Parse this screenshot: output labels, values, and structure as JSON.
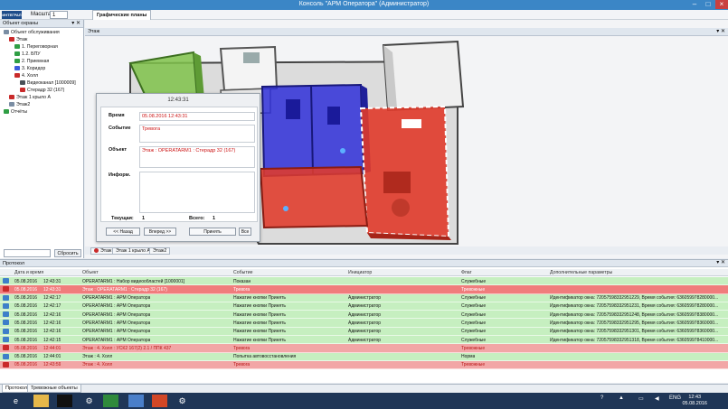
{
  "window": {
    "title": "Консоль \"АРМ Оператора\" (Администратор)"
  },
  "toolbar": {
    "logo_text": "ИНТЕГРАЛ",
    "scale_label": "Масштаб",
    "scale_value": "1",
    "plans_tab": "Графические планы"
  },
  "left_panel": {
    "title": "Объект охраны",
    "items": [
      {
        "label": "Объект обслуживания",
        "level": 0,
        "icon": "building-icon",
        "color": "#7a8da3"
      },
      {
        "label": "Этаж",
        "level": 1,
        "icon": "floor-icon",
        "color": "#c92a2a"
      },
      {
        "label": "1. Переговорная",
        "level": 2,
        "icon": "room-icon",
        "color": "#2f9e44"
      },
      {
        "label": "1.2. БПУ",
        "level": 2,
        "icon": "room-icon",
        "color": "#2f9e44"
      },
      {
        "label": "2. Приемная",
        "level": 2,
        "icon": "room-icon",
        "color": "#2f9e44"
      },
      {
        "label": "3. Коридор",
        "level": 2,
        "icon": "room-icon",
        "color": "#3b5bdb"
      },
      {
        "label": "4. Холл",
        "level": 2,
        "icon": "room-icon",
        "color": "#c92a2a"
      },
      {
        "label": "Видеоканал [1000009]",
        "level": 3,
        "icon": "camera-icon",
        "color": "#495057"
      },
      {
        "label": "Стерадр 32 (167)",
        "level": 3,
        "icon": "sensor-icon",
        "color": "#c92a2a"
      },
      {
        "label": "Этаж 1 крыло А",
        "level": 1,
        "icon": "floor-icon",
        "color": "#c92a2a"
      },
      {
        "label": "Этаж2",
        "level": 1,
        "icon": "floor-icon",
        "color": "#7a8da3"
      },
      {
        "label": "Отчёты",
        "level": 0,
        "icon": "reports-icon",
        "color": "#2f9e44"
      }
    ],
    "reset_label": "Сбросить"
  },
  "plan": {
    "panel_title": "Этаж",
    "floor_tabs": [
      "Этаж",
      "Этаж 1 крыло А",
      "Этаж2"
    ],
    "colors": {
      "green_zone": "#7fc24a",
      "blue_zone": "#2f2fd8",
      "red_zone": "#e03a2a"
    }
  },
  "event_dialog": {
    "time_header": "12:43:31",
    "time_label": "Время",
    "time_value": "05.08.2016 12:43:31",
    "event_label": "Событие",
    "event_value": "Тревога",
    "object_label": "Объект",
    "object_value": "Этаж : OPERATARM1 : Стерадр 32 (167)",
    "info_label": "Информ.",
    "current_label": "Текущая:",
    "current_value": "1",
    "total_label": "Всего:",
    "total_value": "1",
    "back_button": "<< Назад",
    "forward_button": "Вперед >>",
    "accept_button": "Принять",
    "all_button": "Все"
  },
  "protocol": {
    "title": "Протокол",
    "columns": [
      "Дата и время",
      "Объект",
      "Событие",
      "Инициатор",
      "Флаг",
      "Дополнительные параметры"
    ],
    "rows": [
      {
        "date": "05.08.2016",
        "time": "12:43:31",
        "object": "OPERATARM1 : Набор видеообластей [1000001]",
        "event": "Показан",
        "initiator": "",
        "flag": "Служебные",
        "params": "",
        "type": "green"
      },
      {
        "date": "05.08.2016",
        "time": "12:43:31",
        "object": "Этаж : OPERATARM1 : Стерадр 32 (167)",
        "event": "Тревога",
        "initiator": "",
        "flag": "Тревожные",
        "params": "",
        "type": "sel"
      },
      {
        "date": "05.08.2016",
        "time": "12:42:17",
        "object": "OPERATARM1 : АРМ Оператора",
        "event": "Нажатие кнопки Принять",
        "initiator": "Администратор",
        "flag": "Служебные",
        "params": "Идентификатор окна: 72057598332951229, Время события: 636059978280000...",
        "type": "green"
      },
      {
        "date": "05.08.2016",
        "time": "12:42:17",
        "object": "OPERATARM1 : АРМ Оператора",
        "event": "Нажатие кнопки Принять",
        "initiator": "Администратор",
        "flag": "Служебные",
        "params": "Идентификатор окна: 72057598332951231, Время события: 636059978280000...",
        "type": "green"
      },
      {
        "date": "05.08.2016",
        "time": "12:42:16",
        "object": "OPERATARM1 : АРМ Оператора",
        "event": "Нажатие кнопки Принять",
        "initiator": "Администратор",
        "flag": "Служебные",
        "params": "Идентификатор окна: 72057598332951248, Время события: 636059978380000...",
        "type": "green"
      },
      {
        "date": "05.08.2016",
        "time": "12:42:16",
        "object": "OPERATARM1 : АРМ Оператора",
        "event": "Нажатие кнопки Принять",
        "initiator": "Администратор",
        "flag": "Служебные",
        "params": "Идентификатор окна: 72057598332951295, Время события: 636059978360000...",
        "type": "green"
      },
      {
        "date": "05.08.2016",
        "time": "12:42:16",
        "object": "OPERATARM1 : АРМ Оператора",
        "event": "Нажатие кнопки Принять",
        "initiator": "Администратор",
        "flag": "Служебные",
        "params": "Идентификатор окна: 72057598332951301, Время события: 636059978360000...",
        "type": "green"
      },
      {
        "date": "05.08.2016",
        "time": "12:42:15",
        "object": "OPERATARM1 : АРМ Оператора",
        "event": "Нажатие кнопки Принять",
        "initiator": "Администратор",
        "flag": "Служебные",
        "params": "Идентификатор окна: 72057598332951318, Время события: 636059978410000...",
        "type": "green"
      },
      {
        "date": "05.08.2016",
        "time": "12:44:01",
        "object": "Этаж : 4. Холл : УСК2 167(2) 2.1 / ППК 437",
        "event": "Тревога",
        "initiator": "",
        "flag": "Тревожные",
        "params": "",
        "type": "red"
      },
      {
        "date": "05.08.2016",
        "time": "12:44:01",
        "object": "Этаж : 4. Холл",
        "event": "Попытка автовосстановления",
        "initiator": "",
        "flag": "Норма",
        "params": "",
        "type": "green"
      },
      {
        "date": "05.08.2016",
        "time": "12:43:59",
        "object": "Этаж : 4. Холл",
        "event": "Тревога",
        "initiator": "",
        "flag": "Тревожные",
        "params": "",
        "type": "red"
      }
    ],
    "tabs": [
      "Протокол",
      "Тревожные объекты"
    ]
  },
  "taskbar": {
    "lang": "ENG",
    "time": "12:43",
    "date": "05.08.2016"
  }
}
